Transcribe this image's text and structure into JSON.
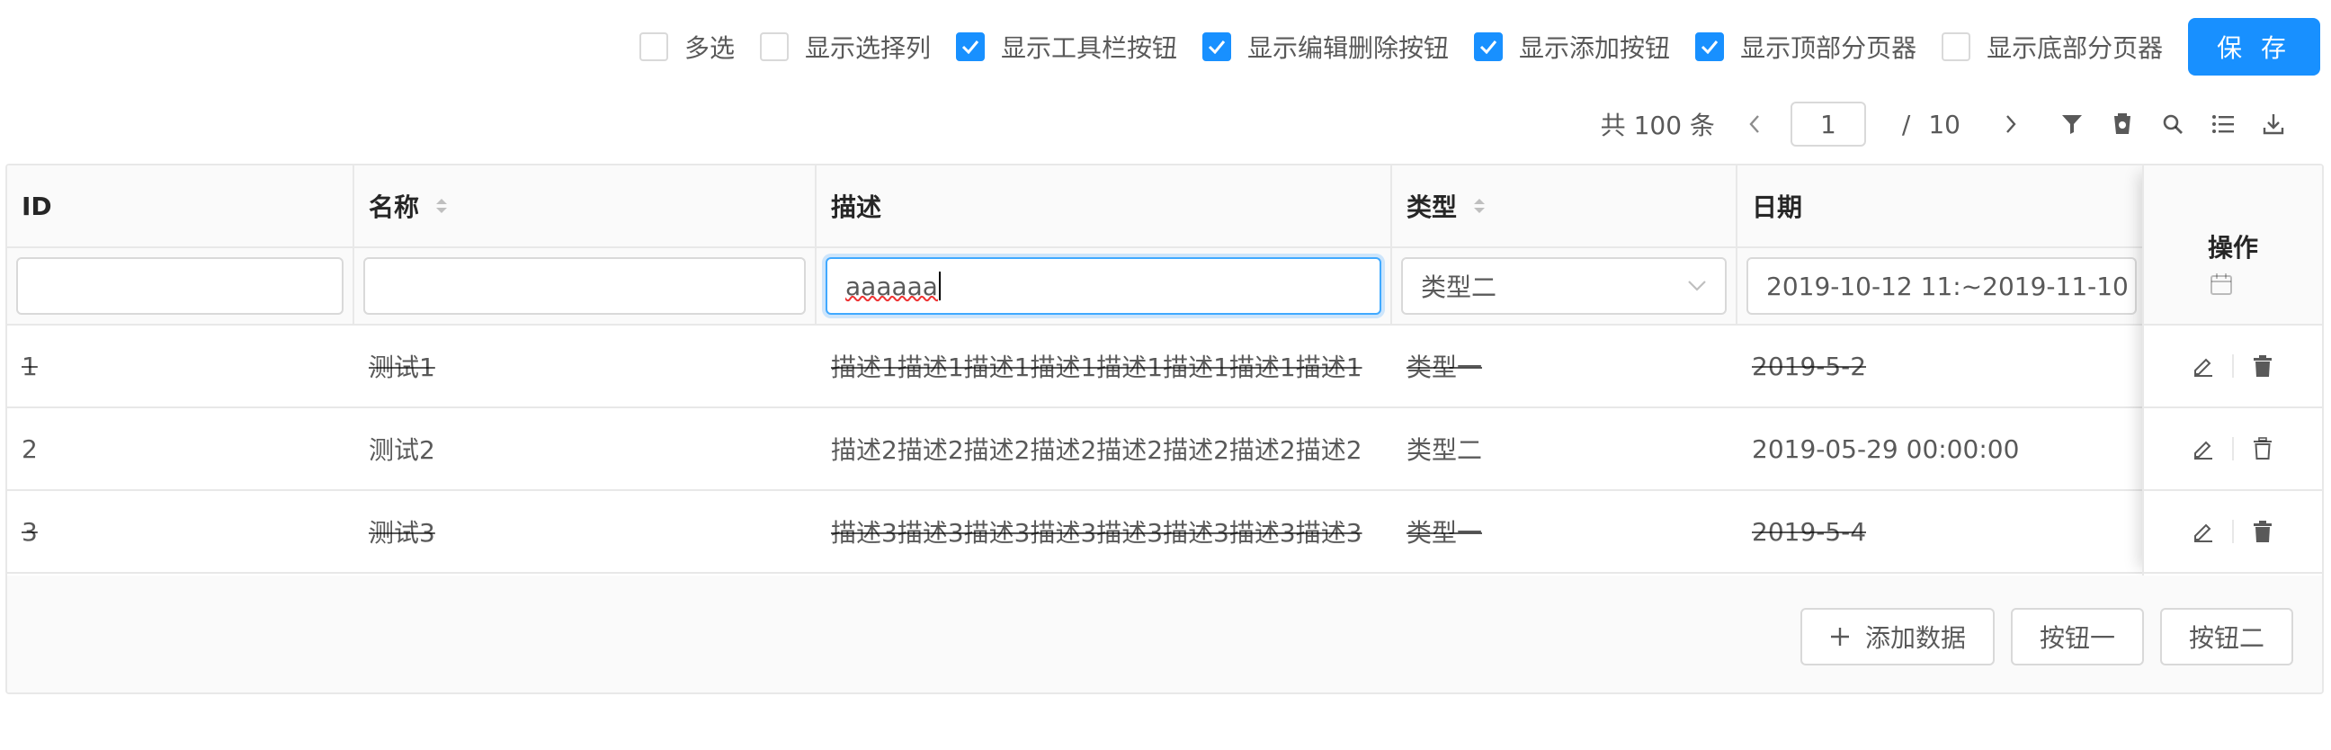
{
  "options": [
    {
      "label": "多选",
      "checked": false
    },
    {
      "label": "显示选择列",
      "checked": false
    },
    {
      "label": "显示工具栏按钮",
      "checked": true
    },
    {
      "label": "显示编辑删除按钮",
      "checked": true
    },
    {
      "label": "显示添加按钮",
      "checked": true
    },
    {
      "label": "显示顶部分页器",
      "checked": true
    },
    {
      "label": "显示底部分页器",
      "checked": false
    }
  ],
  "save_label": "保 存",
  "pager": {
    "total_text": "共 100 条",
    "current_page": "1",
    "slash": "/",
    "page_count": "10"
  },
  "toolbar_icons": [
    "filter-icon",
    "clear-filter-icon",
    "search-icon",
    "column-list-icon",
    "download-icon"
  ],
  "columns": [
    {
      "key": "id",
      "title": "ID",
      "sortable": false
    },
    {
      "key": "name",
      "title": "名称",
      "sortable": true
    },
    {
      "key": "desc",
      "title": "描述",
      "sortable": false
    },
    {
      "key": "type",
      "title": "类型",
      "sortable": true
    },
    {
      "key": "date",
      "title": "日期",
      "sortable": false
    }
  ],
  "filters": {
    "id": "",
    "name": "",
    "desc": "aaaaaa",
    "type": "类型二",
    "date": "2019-10-12 11:~2019-11-10"
  },
  "action_column_title": "操作",
  "rows": [
    {
      "id": "1",
      "name": "测试1",
      "desc": "描述1描述1描述1描述1描述1描述1描述1描述1",
      "type": "类型一",
      "date": "2019-5-2",
      "deleted": true
    },
    {
      "id": "2",
      "name": "测试2",
      "desc": "描述2描述2描述2描述2描述2描述2描述2描述2",
      "type": "类型二",
      "date": "2019-05-29 00:00:00",
      "deleted": false
    },
    {
      "id": "3",
      "name": "测试3",
      "desc": "描述3描述3描述3描述3描述3描述3描述3描述3",
      "type": "类型一",
      "date": "2019-5-4",
      "deleted": true
    }
  ],
  "footer_buttons": {
    "add_label": "添加数据",
    "button_one": "按钮一",
    "button_two": "按钮二"
  },
  "colors": {
    "primary": "#1890ff",
    "border": "#e8e8e8",
    "header_bg": "#fafafa"
  }
}
